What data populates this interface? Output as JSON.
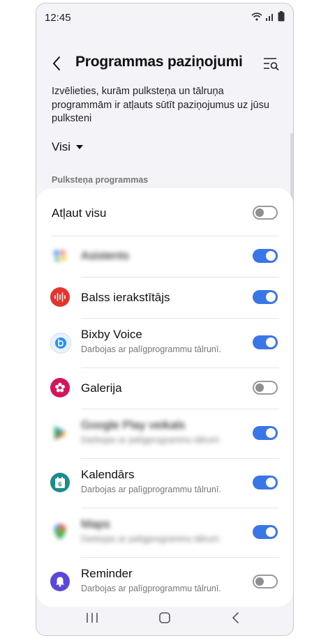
{
  "status_bar": {
    "time": "12:45"
  },
  "header": {
    "title": "Programmas paziņojumi"
  },
  "description": "Izvēlieties, kurām pulksteņa un tālruņa programmām ir atļauts sūtīt paziņojumus uz jūsu pulksteni",
  "filter": {
    "selected": "Visi"
  },
  "section_label": "Pulksteņa programmas",
  "allow_all": {
    "label": "Atļaut visu",
    "on": false
  },
  "apps": [
    {
      "name": "Asistents",
      "sub": "",
      "on": true,
      "blurred": true,
      "icon": "assistant-icon"
    },
    {
      "name": "Balss ierakstītājs",
      "sub": "",
      "on": true,
      "blurred": false,
      "icon": "voice-recorder-icon",
      "color": "#e5342d"
    },
    {
      "name": "Bixby Voice",
      "sub": "Darbojas ar palīgprogrammu tālrunī.",
      "on": true,
      "blurred": false,
      "icon": "bixby-icon",
      "color": "#2b8ff0"
    },
    {
      "name": "Galerija",
      "sub": "",
      "on": false,
      "blurred": false,
      "icon": "gallery-icon",
      "color": "#d6145a"
    },
    {
      "name": "Google Play veikals",
      "sub": "Darbojas ar palīgprogrammu tālrunī.",
      "on": true,
      "blurred": true,
      "icon": "play-store-icon"
    },
    {
      "name": "Kalendārs",
      "sub": "Darbojas ar palīgprogrammu tālrunī.",
      "on": true,
      "blurred": false,
      "icon": "calendar-icon",
      "color": "#1a8c8a",
      "day": "6"
    },
    {
      "name": "Maps",
      "sub": "Darbojas ar palīgprogrammu tālrunī.",
      "on": true,
      "blurred": true,
      "icon": "maps-icon"
    },
    {
      "name": "Reminder",
      "sub": "Darbojas ar palīgprogrammu tālrunī.",
      "on": false,
      "blurred": false,
      "icon": "reminder-icon",
      "color": "#5a49d6"
    }
  ]
}
